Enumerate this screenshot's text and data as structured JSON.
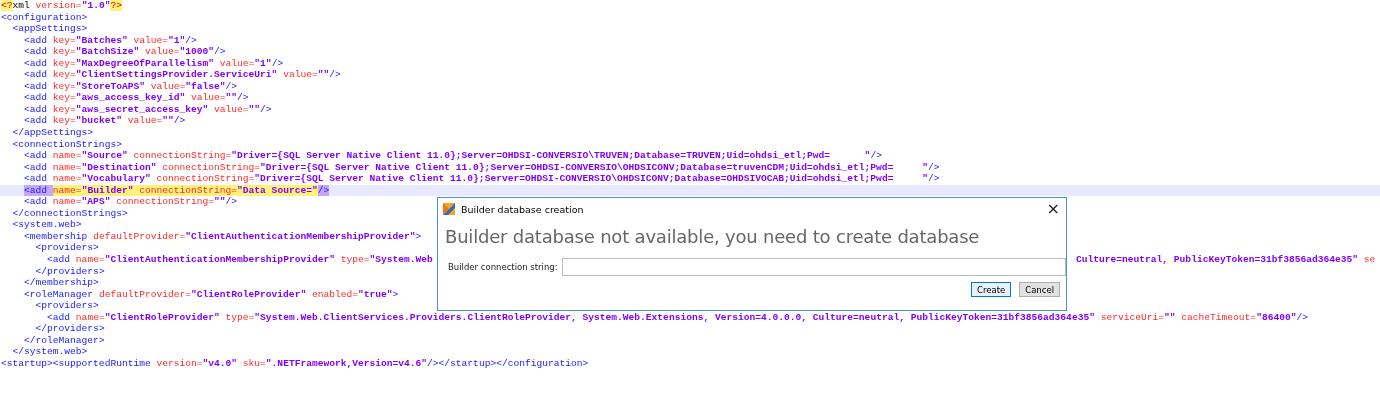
{
  "editor": {
    "lines": [
      {
        "current": false,
        "tokens": [
          {
            "kind": "decl",
            "text": "<?",
            "highlighted": true
          },
          {
            "kind": "text",
            "text": "xml"
          },
          {
            "kind": "attr",
            "text": " version="
          },
          {
            "kind": "value",
            "text": "\"1.0\""
          },
          {
            "kind": "decl",
            "text": "?>",
            "highlighted": true
          }
        ]
      },
      {
        "current": false,
        "tokens": [
          {
            "kind": "tag",
            "text": "<configuration>"
          }
        ],
        "children": [
          {
            "current": false,
            "tokens": [
              {
                "kind": "tag",
                "text": "<appSettings>"
              }
            ],
            "children": [
              {
                "current": false,
                "tokens": [
                  {
                    "kind": "tag",
                    "text": "<add"
                  },
                  {
                    "kind": "attr",
                    "text": " key="
                  },
                  {
                    "kind": "value",
                    "text": "\"Batches\""
                  },
                  {
                    "kind": "attr",
                    "text": " value="
                  },
                  {
                    "kind": "value",
                    "text": "\"1\""
                  },
                  {
                    "kind": "tag",
                    "text": "/>"
                  }
                ]
              },
              {
                "current": false,
                "tokens": [
                  {
                    "kind": "tag",
                    "text": "<add"
                  },
                  {
                    "kind": "attr",
                    "text": " key="
                  },
                  {
                    "kind": "value",
                    "text": "\"BatchSize\""
                  },
                  {
                    "kind": "attr",
                    "text": " value="
                  },
                  {
                    "kind": "value",
                    "text": "\"1000\""
                  },
                  {
                    "kind": "tag",
                    "text": "/>"
                  }
                ]
              },
              {
                "current": false,
                "tokens": [
                  {
                    "kind": "tag",
                    "text": "<add"
                  },
                  {
                    "kind": "attr",
                    "text": " key="
                  },
                  {
                    "kind": "value",
                    "text": "\"MaxDegreeOfParallelism\""
                  },
                  {
                    "kind": "attr",
                    "text": " value="
                  },
                  {
                    "kind": "value",
                    "text": "\"1\""
                  },
                  {
                    "kind": "tag",
                    "text": "/>"
                  }
                ]
              },
              {
                "current": false,
                "tokens": [
                  {
                    "kind": "tag",
                    "text": "<add"
                  },
                  {
                    "kind": "attr",
                    "text": " key="
                  },
                  {
                    "kind": "value",
                    "text": "\"ClientSettingsProvider.ServiceUri\""
                  },
                  {
                    "kind": "attr",
                    "text": " value="
                  },
                  {
                    "kind": "value",
                    "text": "\"\""
                  },
                  {
                    "kind": "tag",
                    "text": "/>"
                  }
                ]
              },
              {
                "current": false,
                "tokens": [
                  {
                    "kind": "tag",
                    "text": "<add"
                  },
                  {
                    "kind": "attr",
                    "text": " key="
                  },
                  {
                    "kind": "value",
                    "text": "\"StoreToAPS\""
                  },
                  {
                    "kind": "attr",
                    "text": " value="
                  },
                  {
                    "kind": "value",
                    "text": "\"false\""
                  },
                  {
                    "kind": "tag",
                    "text": "/>"
                  }
                ]
              },
              {
                "current": false,
                "tokens": [
                  {
                    "kind": "tag",
                    "text": "<add"
                  },
                  {
                    "kind": "attr",
                    "text": " key="
                  },
                  {
                    "kind": "value",
                    "text": "\"aws_access_key_id\""
                  },
                  {
                    "kind": "attr",
                    "text": " value="
                  },
                  {
                    "kind": "value",
                    "text": "\"\""
                  },
                  {
                    "kind": "tag",
                    "text": "/>"
                  }
                ]
              },
              {
                "current": false,
                "tokens": [
                  {
                    "kind": "tag",
                    "text": "<add"
                  },
                  {
                    "kind": "attr",
                    "text": " key="
                  },
                  {
                    "kind": "value",
                    "text": "\"aws_secret_access_key\""
                  },
                  {
                    "kind": "attr",
                    "text": " value="
                  },
                  {
                    "kind": "value",
                    "text": "\"\""
                  },
                  {
                    "kind": "tag",
                    "text": "/>"
                  }
                ]
              },
              {
                "current": false,
                "tokens": [
                  {
                    "kind": "tag",
                    "text": "<add"
                  },
                  {
                    "kind": "attr",
                    "text": " key="
                  },
                  {
                    "kind": "value",
                    "text": "\"bucket\""
                  },
                  {
                    "kind": "attr",
                    "text": " value="
                  },
                  {
                    "kind": "value",
                    "text": "\"\""
                  },
                  {
                    "kind": "tag",
                    "text": "/>"
                  }
                ]
              }
            ]
          },
          {
            "current": false,
            "tokens": [
              {
                "kind": "tag",
                "text": "</appSettings>"
              }
            ]
          },
          {
            "current": false,
            "tokens": [
              {
                "kind": "tag",
                "text": "<connectionStrings>"
              }
            ],
            "children": [
              {
                "current": false,
                "tokens": [
                  {
                    "kind": "tag",
                    "text": "<add"
                  },
                  {
                    "kind": "attr",
                    "text": " name="
                  },
                  {
                    "kind": "value",
                    "text": "\"Source\""
                  },
                  {
                    "kind": "attr",
                    "text": " connectionString="
                  },
                  {
                    "kind": "value",
                    "text": "\"Driver={SQL Server Native Client 11.0};Server=OHDSI-CONVERSIO\\TRUVEN;Database=TRUVEN;Uid=ohdsi_etl;Pwd=      \""
                  },
                  {
                    "kind": "tag",
                    "text": "/>"
                  }
                ]
              },
              {
                "current": false,
                "tokens": [
                  {
                    "kind": "tag",
                    "text": "<add"
                  },
                  {
                    "kind": "attr",
                    "text": " name="
                  },
                  {
                    "kind": "value",
                    "text": "\"Destination\""
                  },
                  {
                    "kind": "attr",
                    "text": " connectionString="
                  },
                  {
                    "kind": "value",
                    "text": "\"Driver={SQL Server Native Client 11.0};Server=OHDSI-CONVERSIO\\OHDSICONV;Database=truvenCDM;Uid=ohdsi_etl;Pwd=     \""
                  },
                  {
                    "kind": "tag",
                    "text": "/>"
                  }
                ]
              },
              {
                "current": false,
                "tokens": [
                  {
                    "kind": "tag",
                    "text": "<add"
                  },
                  {
                    "kind": "attr",
                    "text": " name="
                  },
                  {
                    "kind": "value",
                    "text": "\"Vocabulary\""
                  },
                  {
                    "kind": "attr",
                    "text": " connectionString="
                  },
                  {
                    "kind": "value",
                    "text": "\"Driver={SQL Server Native Client 11.0};Server=OHDSI-CONVERSIO\\OHDSICONV;Database=OHDSIVOCAB;Uid=ohdsi_etl;Pwd=     \""
                  },
                  {
                    "kind": "tag",
                    "text": "/>"
                  }
                ]
              },
              {
                "current": true,
                "tokens": [
                  {
                    "kind": "tag",
                    "text": "<add ",
                    "highlighted": true
                  },
                  {
                    "kind": "attr",
                    "text": "name=",
                    "highlighted": true
                  },
                  {
                    "kind": "value",
                    "text": "\"Builder\" ",
                    "highlighted": true
                  },
                  {
                    "kind": "attr",
                    "text": "connectionString=",
                    "highlighted": true
                  },
                  {
                    "kind": "value",
                    "text": "\"Data Source=\"",
                    "highlighted": true
                  },
                  {
                    "kind": "tag",
                    "text": "/>",
                    "highlighted": true
                  }
                ]
              },
              {
                "current": false,
                "tokens": [
                  {
                    "kind": "tag",
                    "text": "<add"
                  },
                  {
                    "kind": "attr",
                    "text": " name="
                  },
                  {
                    "kind": "value",
                    "text": "\"APS\""
                  },
                  {
                    "kind": "attr",
                    "text": " connectionString="
                  },
                  {
                    "kind": "value",
                    "text": "\"\""
                  },
                  {
                    "kind": "tag",
                    "text": "/>"
                  }
                ]
              }
            ]
          },
          {
            "current": false,
            "tokens": [
              {
                "kind": "tag",
                "text": "</connectionStrings>"
              }
            ]
          },
          {
            "current": false,
            "tokens": [
              {
                "kind": "tag",
                "text": "<system.web>"
              }
            ],
            "children": [
              {
                "current": false,
                "tokens": [
                  {
                    "kind": "tag",
                    "text": "<membership"
                  },
                  {
                    "kind": "attr",
                    "text": " defaultProvider="
                  },
                  {
                    "kind": "value",
                    "text": "\"ClientAuthenticationMembershipProvider\""
                  },
                  {
                    "kind": "tag",
                    "text": ">"
                  }
                ],
                "children": [
                  {
                    "current": false,
                    "tokens": [
                      {
                        "kind": "tag",
                        "text": "<providers>"
                      }
                    ],
                    "children": [
                      {
                        "current": false,
                        "tokens": [
                          {
                            "kind": "tag",
                            "text": "<add"
                          },
                          {
                            "kind": "attr",
                            "text": " name="
                          },
                          {
                            "kind": "value",
                            "text": "\"ClientAuthenticationMembershipProvider\""
                          },
                          {
                            "kind": "attr",
                            "text": " type="
                          },
                          {
                            "kind": "value",
                            "text": "\"System.Web"
                          }
                        ],
                        "tokens_after_dialog": [
                          {
                            "kind": "value",
                            "text": "Culture=neutral, PublicKeyToken=31bf3856ad364e35\""
                          },
                          {
                            "kind": "attr",
                            "text": " se"
                          }
                        ]
                      }
                    ]
                  },
                  {
                    "current": false,
                    "tokens": [
                      {
                        "kind": "tag",
                        "text": "</providers>"
                      }
                    ]
                  }
                ]
              },
              {
                "current": false,
                "tokens": [
                  {
                    "kind": "tag",
                    "text": "</membership>"
                  }
                ]
              },
              {
                "current": false,
                "tokens": [
                  {
                    "kind": "tag",
                    "text": "<roleManager"
                  },
                  {
                    "kind": "attr",
                    "text": " defaultProvider="
                  },
                  {
                    "kind": "value",
                    "text": "\"ClientRoleProvider\""
                  },
                  {
                    "kind": "attr",
                    "text": " enabled="
                  },
                  {
                    "kind": "value",
                    "text": "\"true\""
                  },
                  {
                    "kind": "tag",
                    "text": ">"
                  }
                ],
                "children": [
                  {
                    "current": false,
                    "tokens": [
                      {
                        "kind": "tag",
                        "text": "<providers>"
                      }
                    ],
                    "children": [
                      {
                        "current": false,
                        "tokens": [
                          {
                            "kind": "tag",
                            "text": "<add"
                          },
                          {
                            "kind": "attr",
                            "text": " name="
                          },
                          {
                            "kind": "value",
                            "text": "\"ClientRoleProvider\""
                          },
                          {
                            "kind": "attr",
                            "text": " type="
                          },
                          {
                            "kind": "value",
                            "text": "\"System.Web.ClientServices.Providers.ClientRoleProvider, System.Web.Extensions, Version=4.0.0.0, Culture=neutral, PublicKeyToken=31bf3856ad364e35\""
                          },
                          {
                            "kind": "attr",
                            "text": " serviceUri="
                          },
                          {
                            "kind": "value",
                            "text": "\"\""
                          },
                          {
                            "kind": "attr",
                            "text": " cacheTimeout="
                          },
                          {
                            "kind": "value",
                            "text": "\"86400\""
                          },
                          {
                            "kind": "tag",
                            "text": "/>"
                          }
                        ]
                      }
                    ]
                  },
                  {
                    "current": false,
                    "tokens": [
                      {
                        "kind": "tag",
                        "text": "</providers>"
                      }
                    ]
                  }
                ]
              },
              {
                "current": false,
                "tokens": [
                  {
                    "kind": "tag",
                    "text": "</roleManager>"
                  }
                ]
              }
            ]
          },
          {
            "current": false,
            "tokens": [
              {
                "kind": "tag",
                "text": "</system.web>"
              }
            ]
          }
        ]
      },
      {
        "current": false,
        "tokens": [
          {
            "kind": "tag",
            "text": "<startup><supportedRuntime"
          },
          {
            "kind": "attr",
            "text": " version="
          },
          {
            "kind": "value",
            "text": "\"v4.0\""
          },
          {
            "kind": "attr",
            "text": " sku="
          },
          {
            "kind": "value",
            "text": "\".NETFramework,Version=v4.6\""
          },
          {
            "kind": "tag",
            "text": "/></startup></configuration>"
          }
        ]
      }
    ]
  },
  "dialog": {
    "title": "Builder database creation",
    "close": "×",
    "heading": "Builder database not available, you need to create database",
    "field_label": "Builder connection string:",
    "buttons": [
      {
        "label": "Create",
        "focused": true
      },
      {
        "label": "Cancel",
        "focused": false
      }
    ]
  }
}
